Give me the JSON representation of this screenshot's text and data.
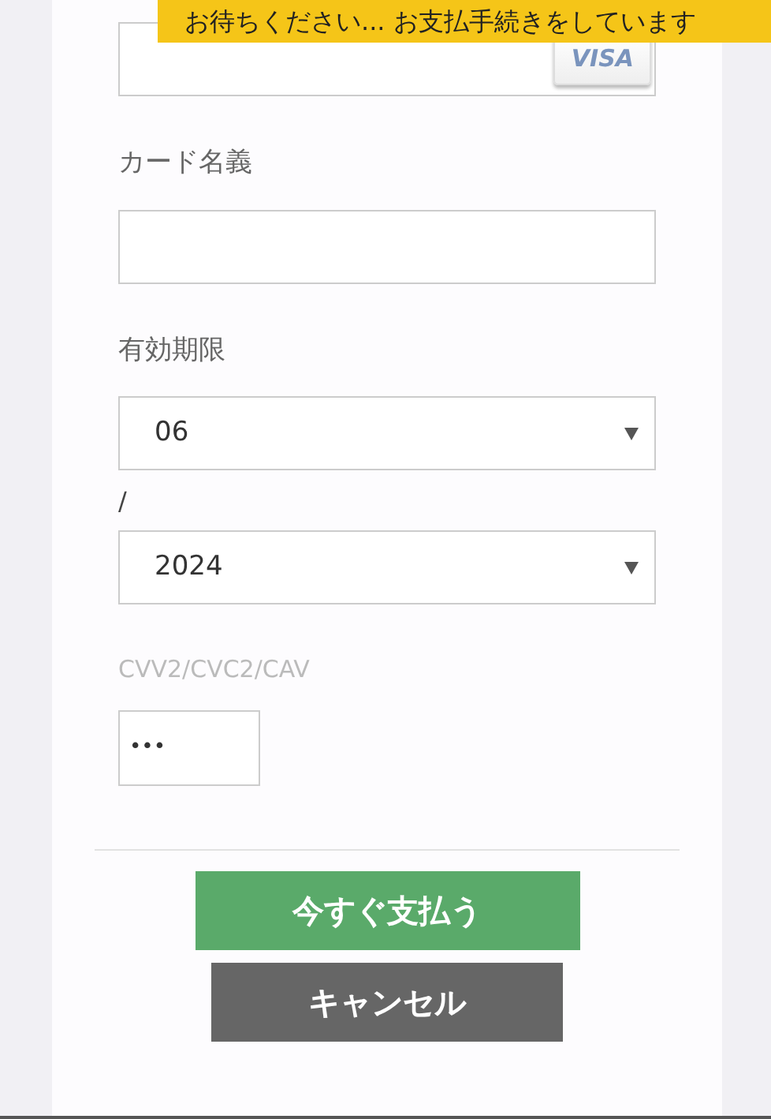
{
  "banner": {
    "text": "お待ちください... お支払手続きをしています"
  },
  "card_number": {
    "brand": "VISA"
  },
  "cardholder": {
    "label": "カード名義"
  },
  "expiry": {
    "label": "有効期限",
    "month": "06",
    "separator": "/",
    "year": "2024"
  },
  "cvv": {
    "label": "CVV2/CVC2/CAV",
    "value": "•••"
  },
  "buttons": [
    {
      "label": "今すぐ支払う",
      "kind": "primary"
    },
    {
      "label": "キャンセル",
      "kind": "secondary"
    }
  ]
}
